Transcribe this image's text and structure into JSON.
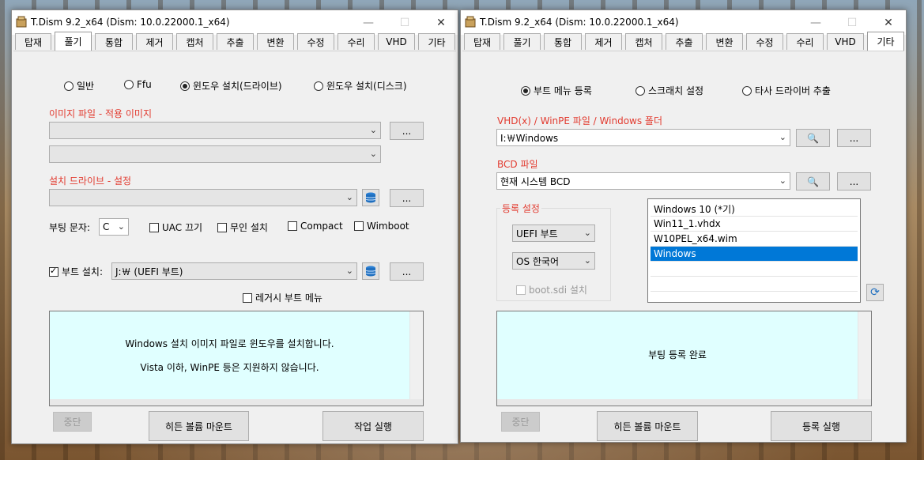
{
  "left": {
    "title": "T.Dism 9.2_x64   (Dism: 10.0.22000.1_x64)",
    "tabs": [
      "탑재",
      "풀기",
      "통합",
      "제거",
      "캡처",
      "추출",
      "변환",
      "수정",
      "수리",
      "VHD",
      "기타"
    ],
    "active_tab": "풀기",
    "modes": [
      "일반",
      "Ffu",
      "윈도우 설치(드라이브)",
      "윈도우 설치(디스크)"
    ],
    "selected_mode": "윈도우 설치(드라이브)",
    "image_label": "이미지 파일 - 적용 이미지",
    "image_value": "",
    "index_value": "",
    "drive_label": "설치 드라이브 - 설정",
    "drive_value": "",
    "browse": "...",
    "boot_letter_label": "부팅 문자:",
    "boot_letter": "C",
    "opt_uac": "UAC 끄기",
    "opt_unattend": "무인 설치",
    "opt_compact": "Compact",
    "opt_wimboot": "Wimboot",
    "boot_install_label": "부트 설치:",
    "boot_install_value": "J:￦      (UEFI 부트)",
    "legacy_menu": "레거시 부트 메뉴",
    "msg1": "Windows 설치 이미지 파일로 윈도우를 설치합니다.",
    "msg2": "Vista 이하, WinPE 등은 지원하지 않습니다.",
    "stop": "중단",
    "mount_hidden": "히든 볼륨 마운트",
    "run": "작업 실행"
  },
  "right": {
    "title": "T.Dism 9.2_x64   (Dism: 10.0.22000.1_x64)",
    "tabs": [
      "탑재",
      "풀기",
      "통합",
      "제거",
      "캡처",
      "추출",
      "변환",
      "수정",
      "수리",
      "VHD",
      "기타"
    ],
    "active_tab": "기타",
    "modes": [
      "부트 메뉴 등록",
      "스크래치 설정",
      "타사 드라이버 추출"
    ],
    "selected_mode": "부트 메뉴 등록",
    "vhd_label": "VHD(x) / WinPE 파일 / Windows 폴더",
    "vhd_value": "I:￦Windows",
    "bcd_label": "BCD 파일",
    "bcd_value": "현재 시스템 BCD",
    "browse": "...",
    "reg_group": "등록 설정",
    "firmware": "UEFI 부트",
    "os_lang": "OS 한국어",
    "boot_sdi": "boot.sdi 설치",
    "entries": [
      "Windows 10    (*기)",
      "Win11_1.vhdx",
      "W10PEL_x64.wim",
      "Windows"
    ],
    "selected_entry": "Windows",
    "msg": "부팅 등록 완료",
    "stop": "중단",
    "mount_hidden": "히든 볼륨 마운트",
    "run": "등록 실행"
  },
  "icons": {
    "min": "—",
    "max": "☐",
    "close": "✕"
  }
}
